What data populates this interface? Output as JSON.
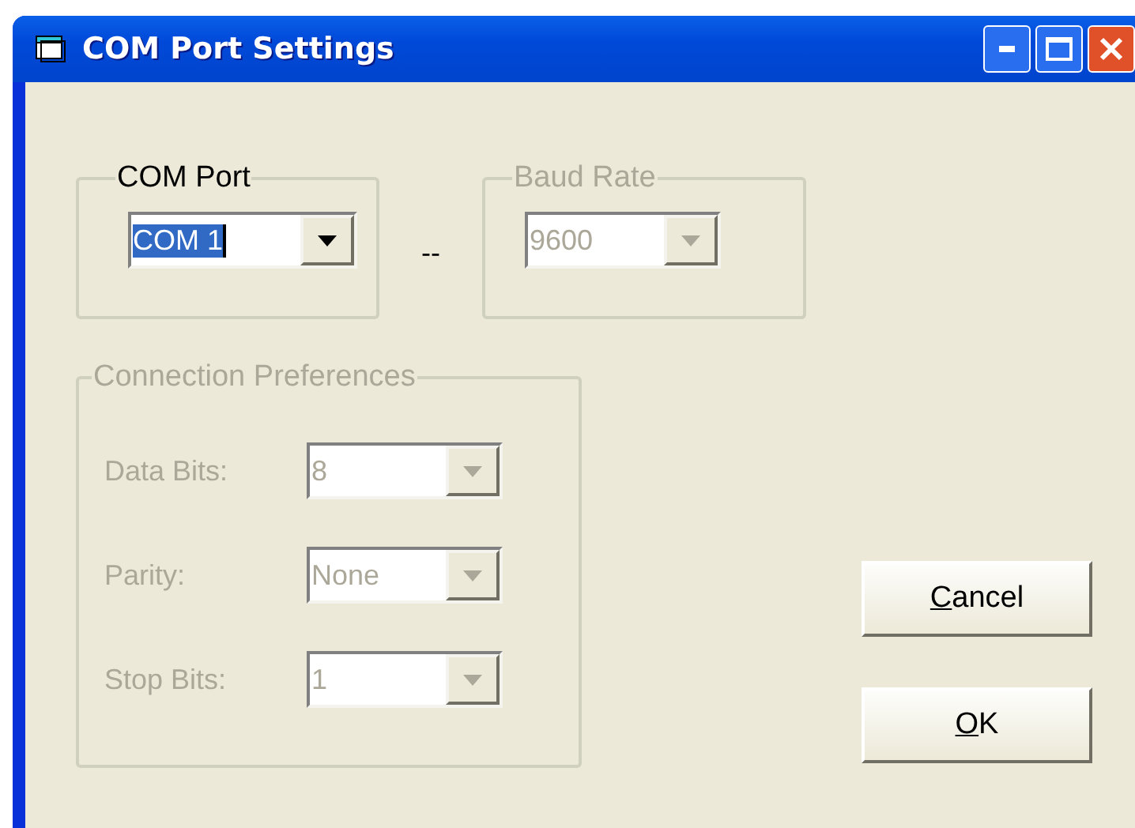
{
  "window": {
    "title": "COM Port Settings"
  },
  "com_port": {
    "title": "COM Port",
    "disabled": false,
    "combo": {
      "value": "COM 1",
      "disabled": false,
      "text_selected": true
    }
  },
  "separator": "--",
  "baud_rate": {
    "title": "Baud Rate",
    "disabled": true,
    "combo": {
      "value": "9600",
      "disabled": true,
      "text_selected": false
    }
  },
  "connection_preferences": {
    "title": "Connection Preferences",
    "disabled": true,
    "fields": [
      {
        "label": "Data Bits:",
        "value": "8",
        "disabled": true
      },
      {
        "label": "Parity:",
        "value": "None",
        "disabled": true
      },
      {
        "label": "Stop Bits:",
        "value": "1",
        "disabled": true
      }
    ]
  },
  "buttons": [
    {
      "label": "Cancel",
      "first_letter_underlined": true
    },
    {
      "label": "OK",
      "first_letter_underlined": true
    }
  ]
}
